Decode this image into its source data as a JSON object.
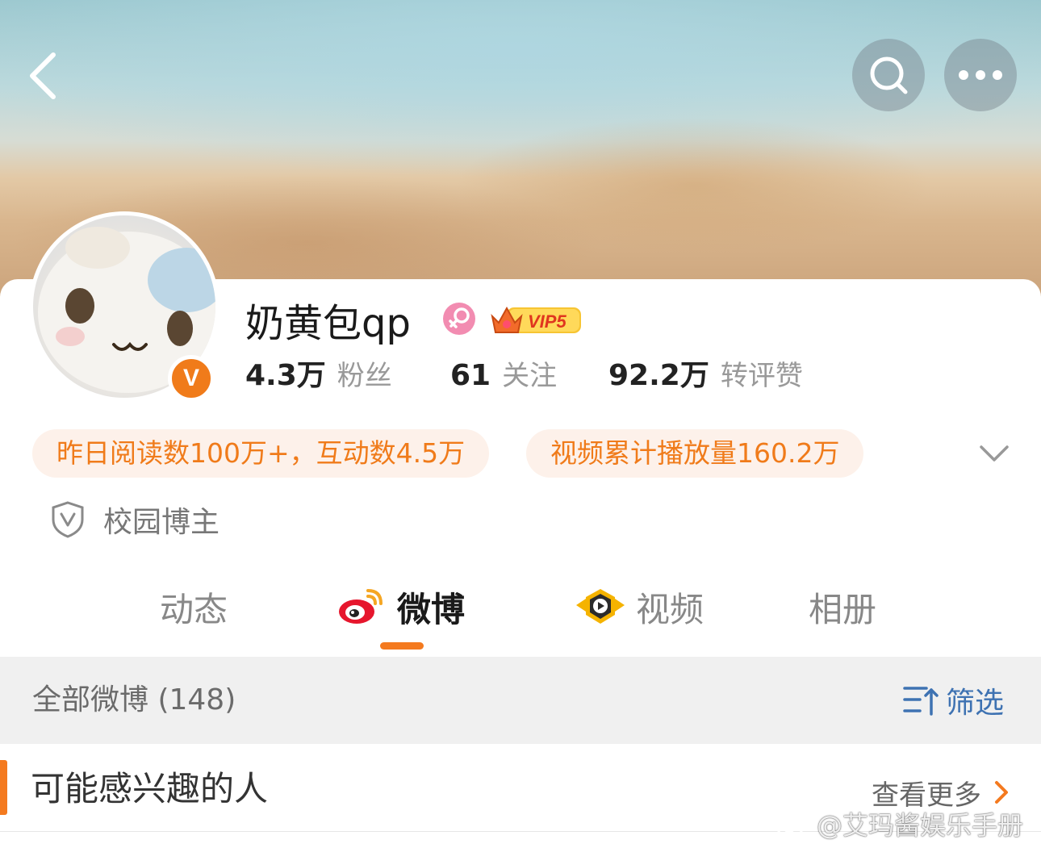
{
  "header": {
    "back_icon": "chevron-left-icon",
    "search_icon": "search-icon",
    "more_icon": "more-dots-icon"
  },
  "profile": {
    "username": "奶黄包qp",
    "gender_icon": "female-icon",
    "vip_label": "VIP5",
    "verified_badge": "V",
    "stats": [
      {
        "value": "4.3万",
        "label": "粉丝"
      },
      {
        "value": "61",
        "label": "关注"
      },
      {
        "value": "92.2万",
        "label": "转评赞"
      }
    ],
    "highlights": [
      "昨日阅读数100万+，互动数4.5万",
      "视频累计播放量160.2万"
    ],
    "campus_label": "校园博主"
  },
  "tabs": [
    {
      "label": "动态",
      "active": false
    },
    {
      "label": "微博",
      "active": true,
      "icon": "weibo-icon"
    },
    {
      "label": "视频",
      "active": false,
      "icon": "video-play-icon"
    },
    {
      "label": "相册",
      "active": false
    }
  ],
  "feed": {
    "all_posts_label": "全部微博 (148)",
    "filter_label": "筛选"
  },
  "suggestions": {
    "title": "可能感兴趣的人",
    "see_more": "查看更多"
  },
  "watermark": "@艾玛酱娱乐手册",
  "colors": {
    "accent_orange": "#f47a1f",
    "pill_bg": "#fdf1ea",
    "filter_blue": "#3e72b2",
    "vip_gold": "#f5b300"
  }
}
